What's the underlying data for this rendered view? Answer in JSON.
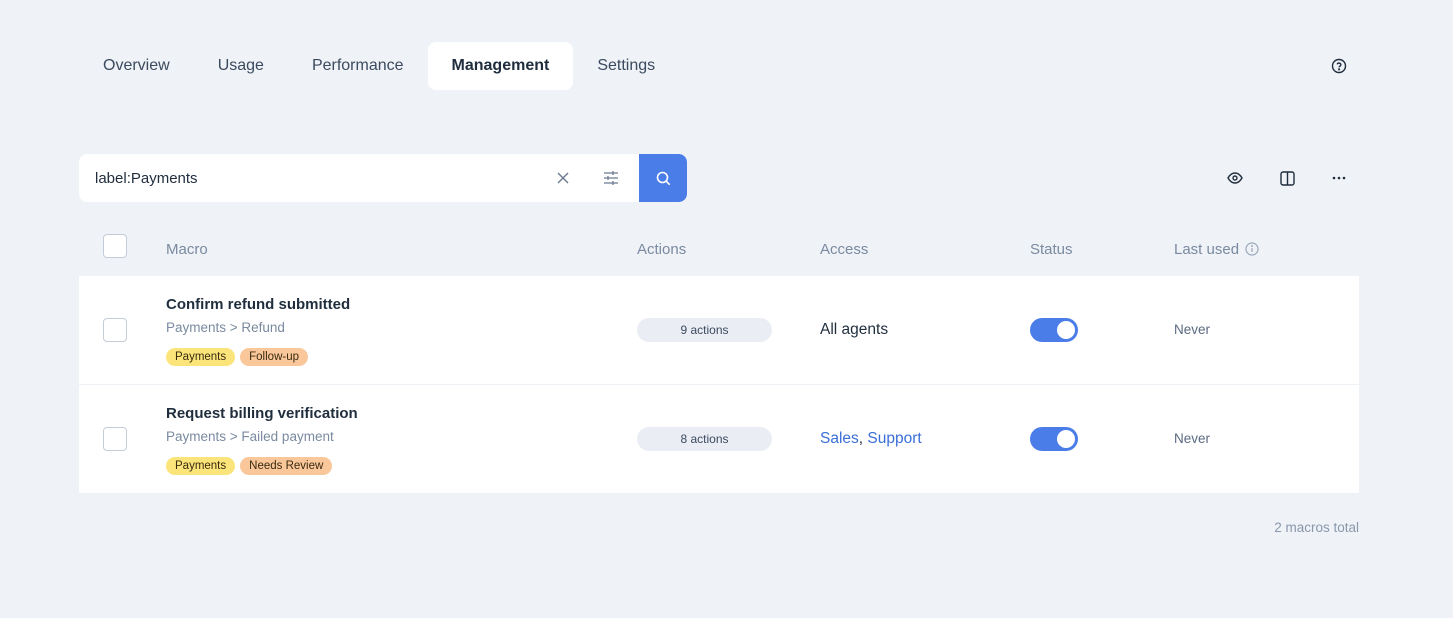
{
  "tabs": [
    {
      "label": "Overview",
      "active": false
    },
    {
      "label": "Usage",
      "active": false
    },
    {
      "label": "Performance",
      "active": false
    },
    {
      "label": "Management",
      "active": true
    },
    {
      "label": "Settings",
      "active": false
    }
  ],
  "help_icon": "help-circle-icon",
  "search": {
    "value": "label:Payments",
    "clear_icon": "close-icon",
    "filter_icon": "sliders-icon",
    "submit_icon": "search-icon"
  },
  "view_tools": {
    "preview_icon": "eye-icon",
    "columns_icon": "columns-icon",
    "more_icon": "more-horizontal-icon"
  },
  "table": {
    "headers": {
      "macro": "Macro",
      "actions": "Actions",
      "access": "Access",
      "status": "Status",
      "last_used": "Last used"
    },
    "rows": [
      {
        "title": "Confirm refund submitted",
        "path": "Payments > Refund",
        "tags": [
          "Payments",
          "Follow-up"
        ],
        "actions": "9 actions",
        "access_text": "All agents",
        "access_links": [],
        "enabled": true,
        "last_used": "Never"
      },
      {
        "title": "Request billing verification",
        "path": "Payments > Failed payment",
        "tags": [
          "Payments",
          "Needs Review"
        ],
        "actions": "8 actions",
        "access_text": "",
        "access_links": [
          "Sales",
          "Support"
        ],
        "enabled": true,
        "last_used": "Never"
      }
    ]
  },
  "footer": {
    "count": "2 macros total"
  },
  "colors": {
    "accent": "#4a7de8",
    "background": "#eff2f7",
    "tag_yellow": "#fbe57a",
    "tag_orange": "#f9c79a"
  }
}
